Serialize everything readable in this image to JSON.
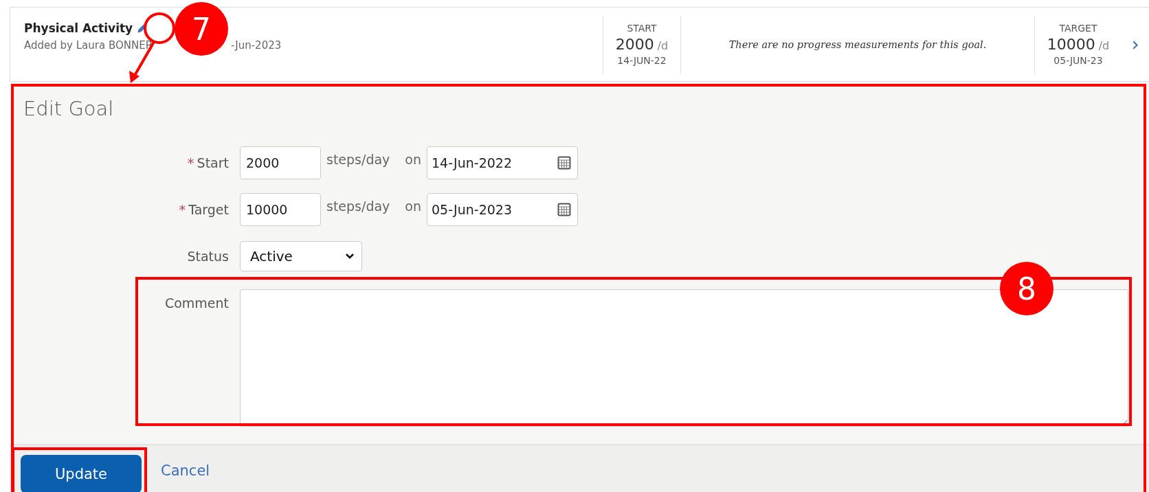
{
  "goal": {
    "title": "Physical Activity",
    "added_by": "Added by Laura BONNER",
    "added_date_visible": "-Jun-2023",
    "start": {
      "label": "START",
      "value": "2000",
      "unit": "/d",
      "date": "14-JUN-22"
    },
    "message": "There are no progress measurements for this goal.",
    "target": {
      "label": "TARGET",
      "value": "10000",
      "unit": "/d",
      "date": "05-JUN-23"
    },
    "chevron": "›"
  },
  "edit_goal": {
    "heading": "Edit Goal",
    "rows": [
      {
        "kind": "range",
        "label": "Start",
        "required_mark": "*",
        "value": "2000",
        "unit": "steps/day",
        "on": "on",
        "date": "14-Jun-2022"
      },
      {
        "kind": "range",
        "label": "Target",
        "required_mark": "*",
        "value": "10000",
        "unit": "steps/day",
        "on": "on",
        "date": "05-Jun-2023"
      },
      {
        "kind": "select",
        "label": "Status",
        "value": "Active"
      },
      {
        "kind": "textarea",
        "label": "Comment",
        "value": ""
      }
    ],
    "buttons": [
      {
        "kind": "primary",
        "label": "Update"
      },
      {
        "kind": "link",
        "label": "Cancel"
      }
    ]
  },
  "callouts": [
    "7",
    "8"
  ]
}
